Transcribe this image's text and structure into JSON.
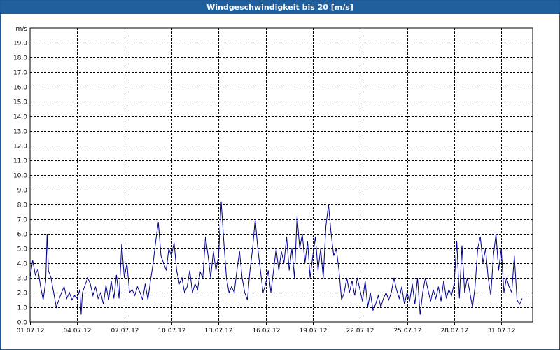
{
  "window": {
    "title": "Windgeschwindigkeit bis 20 [m/s]"
  },
  "chart_data": {
    "type": "line",
    "title": "Windgeschwindigkeit bis 20 [m/s]",
    "ylabel": "m/s",
    "xlabel": "",
    "ylim": [
      0,
      20
    ],
    "yticks": [
      "0,0",
      "1,0",
      "2,0",
      "3,0",
      "4,0",
      "5,0",
      "6,0",
      "7,0",
      "8,0",
      "9,0",
      "10,0",
      "11,0",
      "12,0",
      "13,0",
      "14,0",
      "15,0",
      "16,0",
      "17,0",
      "18,0",
      "19,0"
    ],
    "xlim": [
      "2012-07-01",
      "2012-08-02"
    ],
    "xticks": [
      {
        "date": "2012-07-01",
        "label": "01.07.12"
      },
      {
        "date": "2012-07-04",
        "label": "04.07.12"
      },
      {
        "date": "2012-07-07",
        "label": "07.07.12"
      },
      {
        "date": "2012-07-10",
        "label": "10.07.12"
      },
      {
        "date": "2012-07-13",
        "label": "13.07.12"
      },
      {
        "date": "2012-07-16",
        "label": "16.07.12"
      },
      {
        "date": "2012-07-19",
        "label": "19.07.12"
      },
      {
        "date": "2012-07-22",
        "label": "22.07.12"
      },
      {
        "date": "2012-07-25",
        "label": "25.07.12"
      },
      {
        "date": "2012-07-28",
        "label": "28.07.12"
      },
      {
        "date": "2012-07-31",
        "label": "31.07.12"
      }
    ],
    "grid": true,
    "series_color": "#00008b",
    "series": [
      {
        "points": [
          [
            "2012-07-01 00:00",
            3.0
          ],
          [
            "2012-07-01 04:00",
            4.2
          ],
          [
            "2012-07-01 08:00",
            3.2
          ],
          [
            "2012-07-01 12:00",
            3.6
          ],
          [
            "2012-07-01 16:00",
            2.4
          ],
          [
            "2012-07-01 20:00",
            1.5
          ],
          [
            "2012-07-02 00:00",
            2.8
          ],
          [
            "2012-07-02 02:00",
            6.0
          ],
          [
            "2012-07-02 04:00",
            3.5
          ],
          [
            "2012-07-02 08:00",
            3.0
          ],
          [
            "2012-07-02 12:00",
            2.0
          ],
          [
            "2012-07-02 16:00",
            1.0
          ],
          [
            "2012-07-02 20:00",
            1.5
          ],
          [
            "2012-07-03 00:00",
            2.0
          ],
          [
            "2012-07-03 04:00",
            2.4
          ],
          [
            "2012-07-03 08:00",
            1.6
          ],
          [
            "2012-07-03 12:00",
            2.0
          ],
          [
            "2012-07-03 16:00",
            1.5
          ],
          [
            "2012-07-03 20:00",
            1.8
          ],
          [
            "2012-07-04 00:00",
            1.6
          ],
          [
            "2012-07-04 04:00",
            2.2
          ],
          [
            "2012-07-04 06:00",
            0.5
          ],
          [
            "2012-07-04 08:00",
            2.0
          ],
          [
            "2012-07-04 12:00",
            2.5
          ],
          [
            "2012-07-04 16:00",
            3.0
          ],
          [
            "2012-07-04 20:00",
            2.6
          ],
          [
            "2012-07-05 00:00",
            1.8
          ],
          [
            "2012-07-05 04:00",
            2.4
          ],
          [
            "2012-07-05 08:00",
            1.6
          ],
          [
            "2012-07-05 12:00",
            2.0
          ],
          [
            "2012-07-05 16:00",
            1.2
          ],
          [
            "2012-07-05 20:00",
            2.5
          ],
          [
            "2012-07-06 00:00",
            1.5
          ],
          [
            "2012-07-06 04:00",
            2.8
          ],
          [
            "2012-07-06 08:00",
            1.6
          ],
          [
            "2012-07-06 12:00",
            3.2
          ],
          [
            "2012-07-06 16:00",
            1.6
          ],
          [
            "2012-07-06 20:00",
            5.3
          ],
          [
            "2012-07-07 00:00",
            3.0
          ],
          [
            "2012-07-07 04:00",
            4.0
          ],
          [
            "2012-07-07 08:00",
            2.0
          ],
          [
            "2012-07-07 12:00",
            2.2
          ],
          [
            "2012-07-07 16:00",
            1.8
          ],
          [
            "2012-07-07 20:00",
            2.4
          ],
          [
            "2012-07-08 00:00",
            2.0
          ],
          [
            "2012-07-08 04:00",
            1.5
          ],
          [
            "2012-07-08 08:00",
            2.6
          ],
          [
            "2012-07-08 12:00",
            1.5
          ],
          [
            "2012-07-08 16:00",
            2.8
          ],
          [
            "2012-07-08 20:00",
            4.0
          ],
          [
            "2012-07-09 00:00",
            5.5
          ],
          [
            "2012-07-09 04:00",
            6.8
          ],
          [
            "2012-07-09 08:00",
            4.5
          ],
          [
            "2012-07-09 12:00",
            4.0
          ],
          [
            "2012-07-09 16:00",
            3.5
          ],
          [
            "2012-07-09 20:00",
            5.0
          ],
          [
            "2012-07-10 00:00",
            4.5
          ],
          [
            "2012-07-10 04:00",
            5.4
          ],
          [
            "2012-07-10 08:00",
            3.5
          ],
          [
            "2012-07-10 12:00",
            2.6
          ],
          [
            "2012-07-10 16:00",
            3.0
          ],
          [
            "2012-07-10 20:00",
            2.0
          ],
          [
            "2012-07-11 00:00",
            2.4
          ],
          [
            "2012-07-11 04:00",
            3.5
          ],
          [
            "2012-07-11 08:00",
            2.0
          ],
          [
            "2012-07-11 12:00",
            2.6
          ],
          [
            "2012-07-11 16:00",
            2.2
          ],
          [
            "2012-07-11 20:00",
            3.4
          ],
          [
            "2012-07-12 00:00",
            3.0
          ],
          [
            "2012-07-12 04:00",
            5.8
          ],
          [
            "2012-07-12 08:00",
            4.5
          ],
          [
            "2012-07-12 12:00",
            3.0
          ],
          [
            "2012-07-12 16:00",
            4.8
          ],
          [
            "2012-07-12 20:00",
            3.5
          ],
          [
            "2012-07-13 00:00",
            4.5
          ],
          [
            "2012-07-13 04:00",
            8.2
          ],
          [
            "2012-07-13 08:00",
            5.5
          ],
          [
            "2012-07-13 12:00",
            3.0
          ],
          [
            "2012-07-13 16:00",
            2.0
          ],
          [
            "2012-07-13 20:00",
            2.4
          ],
          [
            "2012-07-14 00:00",
            2.0
          ],
          [
            "2012-07-14 04:00",
            3.5
          ],
          [
            "2012-07-14 08:00",
            4.8
          ],
          [
            "2012-07-14 12:00",
            3.0
          ],
          [
            "2012-07-14 16:00",
            2.0
          ],
          [
            "2012-07-14 20:00",
            1.5
          ],
          [
            "2012-07-15 00:00",
            3.5
          ],
          [
            "2012-07-15 04:00",
            5.0
          ],
          [
            "2012-07-15 08:00",
            7.0
          ],
          [
            "2012-07-15 12:00",
            5.0
          ],
          [
            "2012-07-15 16:00",
            3.5
          ],
          [
            "2012-07-15 20:00",
            2.0
          ],
          [
            "2012-07-16 00:00",
            2.6
          ],
          [
            "2012-07-16 04:00",
            3.5
          ],
          [
            "2012-07-16 08:00",
            2.0
          ],
          [
            "2012-07-16 12:00",
            3.5
          ],
          [
            "2012-07-16 16:00",
            5.0
          ],
          [
            "2012-07-16 20:00",
            3.5
          ],
          [
            "2012-07-17 00:00",
            4.8
          ],
          [
            "2012-07-17 04:00",
            4.0
          ],
          [
            "2012-07-17 08:00",
            5.8
          ],
          [
            "2012-07-17 12:00",
            3.5
          ],
          [
            "2012-07-17 16:00",
            5.0
          ],
          [
            "2012-07-17 20:00",
            3.0
          ],
          [
            "2012-07-18 00:00",
            7.2
          ],
          [
            "2012-07-18 04:00",
            5.0
          ],
          [
            "2012-07-18 08:00",
            6.0
          ],
          [
            "2012-07-18 12:00",
            4.0
          ],
          [
            "2012-07-18 16:00",
            5.5
          ],
          [
            "2012-07-18 20:00",
            3.0
          ],
          [
            "2012-07-19 00:00",
            4.5
          ],
          [
            "2012-07-19 04:00",
            5.8
          ],
          [
            "2012-07-19 08:00",
            3.5
          ],
          [
            "2012-07-19 12:00",
            5.0
          ],
          [
            "2012-07-19 16:00",
            3.0
          ],
          [
            "2012-07-19 20:00",
            6.5
          ],
          [
            "2012-07-20 00:00",
            8.0
          ],
          [
            "2012-07-20 04:00",
            6.0
          ],
          [
            "2012-07-20 08:00",
            4.5
          ],
          [
            "2012-07-20 12:00",
            5.0
          ],
          [
            "2012-07-20 16:00",
            3.5
          ],
          [
            "2012-07-20 20:00",
            1.5
          ],
          [
            "2012-07-21 00:00",
            2.0
          ],
          [
            "2012-07-21 04:00",
            3.0
          ],
          [
            "2012-07-21 08:00",
            2.0
          ],
          [
            "2012-07-21 12:00",
            2.8
          ],
          [
            "2012-07-21 16:00",
            1.8
          ],
          [
            "2012-07-21 20:00",
            3.0
          ],
          [
            "2012-07-22 00:00",
            2.2
          ],
          [
            "2012-07-22 04:00",
            1.4
          ],
          [
            "2012-07-22 08:00",
            2.8
          ],
          [
            "2012-07-22 12:00",
            1.0
          ],
          [
            "2012-07-22 16:00",
            2.0
          ],
          [
            "2012-07-22 20:00",
            0.8
          ],
          [
            "2012-07-23 00:00",
            1.2
          ],
          [
            "2012-07-23 04:00",
            1.8
          ],
          [
            "2012-07-23 08:00",
            1.0
          ],
          [
            "2012-07-23 12:00",
            1.6
          ],
          [
            "2012-07-23 16:00",
            2.0
          ],
          [
            "2012-07-23 20:00",
            1.5
          ],
          [
            "2012-07-24 00:00",
            2.0
          ],
          [
            "2012-07-24 04:00",
            3.0
          ],
          [
            "2012-07-24 08:00",
            2.2
          ],
          [
            "2012-07-24 12:00",
            1.6
          ],
          [
            "2012-07-24 16:00",
            2.4
          ],
          [
            "2012-07-24 20:00",
            1.2
          ],
          [
            "2012-07-25 00:00",
            2.0
          ],
          [
            "2012-07-25 04:00",
            1.4
          ],
          [
            "2012-07-25 08:00",
            2.6
          ],
          [
            "2012-07-25 12:00",
            1.2
          ],
          [
            "2012-07-25 16:00",
            3.0
          ],
          [
            "2012-07-25 20:00",
            0.5
          ],
          [
            "2012-07-26 00:00",
            2.0
          ],
          [
            "2012-07-26 04:00",
            3.0
          ],
          [
            "2012-07-26 08:00",
            2.2
          ],
          [
            "2012-07-26 12:00",
            1.4
          ],
          [
            "2012-07-26 16:00",
            2.2
          ],
          [
            "2012-07-26 20:00",
            1.6
          ],
          [
            "2012-07-27 00:00",
            2.4
          ],
          [
            "2012-07-27 04:00",
            1.4
          ],
          [
            "2012-07-27 08:00",
            2.8
          ],
          [
            "2012-07-27 12:00",
            1.6
          ],
          [
            "2012-07-27 16:00",
            2.2
          ],
          [
            "2012-07-27 20:00",
            1.8
          ],
          [
            "2012-07-28 00:00",
            2.6
          ],
          [
            "2012-07-28 04:00",
            5.5
          ],
          [
            "2012-07-28 08:00",
            1.6
          ],
          [
            "2012-07-28 12:00",
            5.2
          ],
          [
            "2012-07-28 16:00",
            2.0
          ],
          [
            "2012-07-28 20:00",
            3.0
          ],
          [
            "2012-07-29 00:00",
            2.0
          ],
          [
            "2012-07-29 04:00",
            1.0
          ],
          [
            "2012-07-29 08:00",
            2.4
          ],
          [
            "2012-07-29 12:00",
            5.0
          ],
          [
            "2012-07-29 16:00",
            5.8
          ],
          [
            "2012-07-29 20:00",
            4.0
          ],
          [
            "2012-07-30 00:00",
            5.0
          ],
          [
            "2012-07-30 04:00",
            3.0
          ],
          [
            "2012-07-30 08:00",
            1.8
          ],
          [
            "2012-07-30 12:00",
            4.5
          ],
          [
            "2012-07-30 16:00",
            6.0
          ],
          [
            "2012-07-30 20:00",
            3.5
          ],
          [
            "2012-07-31 00:00",
            5.0
          ],
          [
            "2012-07-31 04:00",
            2.0
          ],
          [
            "2012-07-31 08:00",
            3.0
          ],
          [
            "2012-07-31 12:00",
            2.4
          ],
          [
            "2012-07-31 16:00",
            2.0
          ],
          [
            "2012-07-31 20:00",
            4.5
          ],
          [
            "2012-08-01 00:00",
            1.5
          ],
          [
            "2012-08-01 04:00",
            1.2
          ],
          [
            "2012-08-01 08:00",
            1.6
          ]
        ]
      }
    ]
  }
}
